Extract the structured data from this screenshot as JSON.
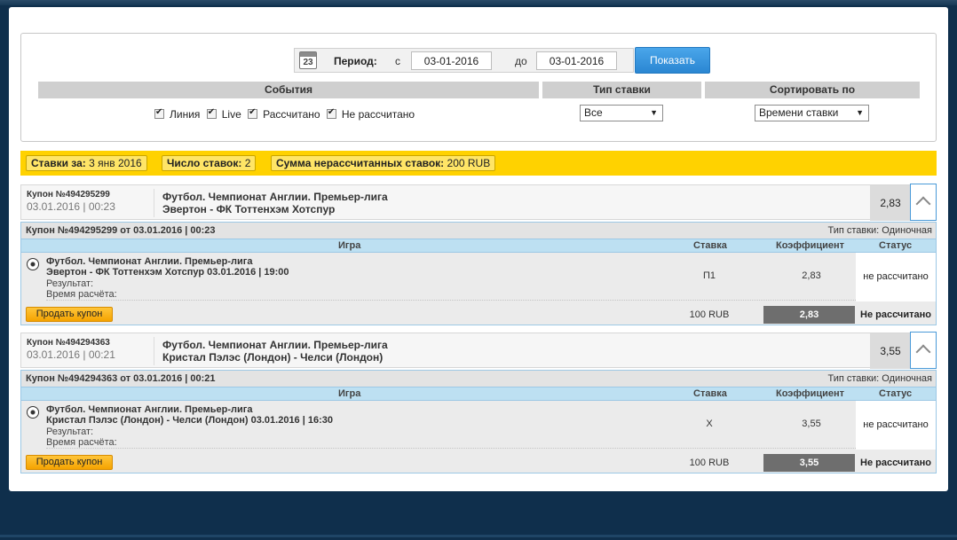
{
  "filter": {
    "period_label": "Период:",
    "from_label": "с",
    "to_label": "до",
    "date_from": "03-01-2016",
    "date_to": "03-01-2016",
    "calendar_day": "23",
    "show_button": "Показать",
    "headers": {
      "events": "События",
      "bet_type": "Тип ставки",
      "sort_by": "Сортировать по"
    },
    "checkboxes": [
      {
        "label": "Линия",
        "checked": true
      },
      {
        "label": "Live",
        "checked": true
      },
      {
        "label": "Рассчитано",
        "checked": true
      },
      {
        "label": "Не рассчитано",
        "checked": true
      }
    ],
    "bet_type_value": "Все",
    "sort_value": "Времени ставки"
  },
  "stats": {
    "bets_for_label": "Ставки за:",
    "bets_for_value": "3 янв 2016",
    "count_label": "Число ставок:",
    "count_value": "2",
    "sum_label": "Сумма нерассчитанных ставок:",
    "sum_value": "200 RUB"
  },
  "columns": {
    "game": "Игра",
    "stake": "Ставка",
    "coef": "Коэффициент",
    "status": "Статус"
  },
  "coupons": [
    {
      "number": "Купон №494295299",
      "datetime": "03.01.2016 | 00:23",
      "league": "Футбол. Чемпионат Англии. Премьер-лига",
      "match": "Эвертон - ФК Тоттенхэм Хотспур",
      "odd": "2,83",
      "title": "Купон №494295299 от 03.01.2016 | 00:23",
      "bet_type": "Тип ставки: Одиночная",
      "row": {
        "league": "Футбол. Чемпионат Англии. Премьер-лига",
        "match": "Эвертон - ФК Тоттенхэм Хотспур 03.01.2016 | 19:00",
        "result_label": "Результат:",
        "time_label": "Время расчёта:",
        "stake": "П1",
        "coef": "2,83",
        "status": "не рассчитано"
      },
      "foot": {
        "sell_button": "Продать купон",
        "amount": "100 RUB",
        "coef": "2,83",
        "status": "Не рассчитано"
      }
    },
    {
      "number": "Купон №494294363",
      "datetime": "03.01.2016 | 00:21",
      "league": "Футбол. Чемпионат Англии. Премьер-лига",
      "match": "Кристал Пэлэс (Лондон) - Челси (Лондон)",
      "odd": "3,55",
      "title": "Купон №494294363 от 03.01.2016 | 00:21",
      "bet_type": "Тип ставки: Одиночная",
      "row": {
        "league": "Футбол. Чемпионат Англии. Премьер-лига",
        "match": "Кристал Пэлэс (Лондон) - Челси (Лондон) 03.01.2016 | 16:30",
        "result_label": "Результат:",
        "time_label": "Время расчёта:",
        "stake": "X",
        "coef": "3,55",
        "status": "не рассчитано"
      },
      "foot": {
        "sell_button": "Продать купон",
        "amount": "100 RUB",
        "coef": "3,55",
        "status": "Не рассчитано"
      }
    }
  ]
}
